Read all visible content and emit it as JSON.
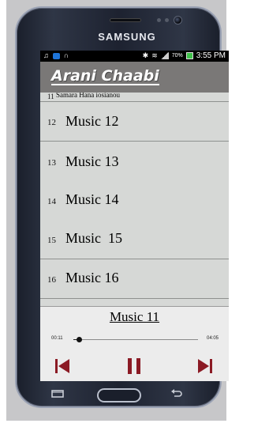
{
  "device": {
    "brand": "SAMSUNG"
  },
  "status_bar": {
    "battery": "70%",
    "time": "3:55 PM"
  },
  "app": {
    "title": "Arani Chaabi"
  },
  "list": {
    "partial_item": {
      "number": "11",
      "title": "Samara Hana iosianou"
    },
    "items": [
      {
        "number": "12",
        "title": "Music 12"
      },
      {
        "number": "13",
        "title": "Music 13"
      },
      {
        "number": "14",
        "title": "Music 14"
      },
      {
        "number": "15",
        "title": "Music  15"
      },
      {
        "number": "16",
        "title": "Music 16"
      }
    ]
  },
  "player": {
    "now_playing": "Music 11",
    "current_time": "00:11",
    "total_time": "04:05",
    "progress_fraction": 0.045,
    "accent_color": "#8b1a24",
    "controls": {
      "prev": "skip-previous-icon",
      "play_pause": "pause-icon",
      "next": "skip-next-icon"
    }
  }
}
